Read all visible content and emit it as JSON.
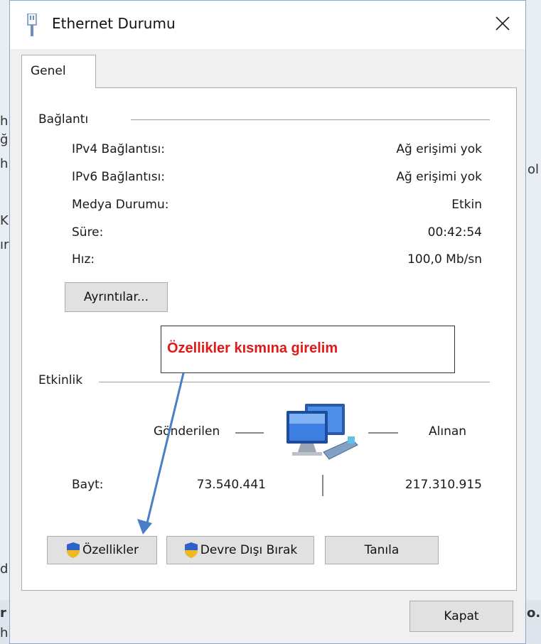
{
  "window": {
    "title": "Ethernet Durumu"
  },
  "tab": {
    "label": "Genel"
  },
  "connection": {
    "group_label": "Bağlantı",
    "rows": [
      {
        "label": "IPv4 Bağlantısı:",
        "value": "Ağ erişimi yok"
      },
      {
        "label": "IPv6 Bağlantısı:",
        "value": "Ağ erişimi yok"
      },
      {
        "label": "Medya Durumu:",
        "value": "Etkin"
      },
      {
        "label": "Süre:",
        "value": "00:42:54"
      },
      {
        "label": "Hız:",
        "value": "100,0 Mb/sn"
      }
    ],
    "details_button": "Ayrıntılar..."
  },
  "activity": {
    "group_label": "Etkinlik",
    "sent_label": "Gönderilen",
    "received_label": "Alınan",
    "bytes_label": "Bayt:",
    "sent_bytes": "73.540.441",
    "received_bytes": "217.310.915"
  },
  "buttons": {
    "properties": "Özellikler",
    "disable": "Devre Dışı Bırak",
    "diagnose": "Tanıla",
    "close": "Kapat"
  },
  "annotation": {
    "text": "Özellikler kısmına girelim",
    "color": "#e01818",
    "arrow_color": "#4a7ec8"
  },
  "background_fragments": [
    "h",
    "ği",
    "h",
    "K",
    "ır",
    "ol",
    "d",
    "r",
    "h",
    "o."
  ]
}
